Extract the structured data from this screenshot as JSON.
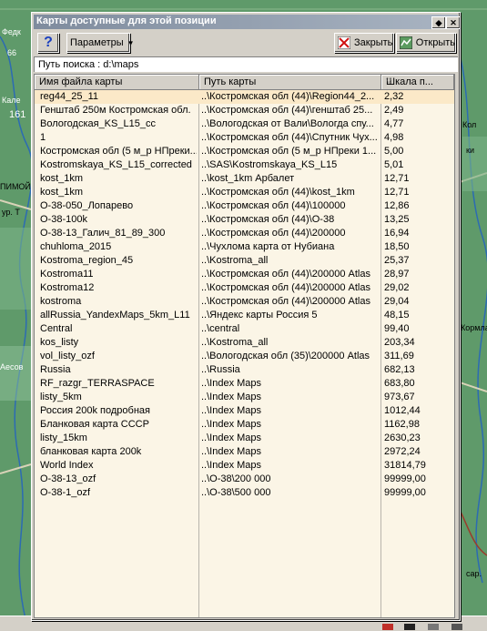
{
  "window": {
    "title": "Карты доступные для этой позиции",
    "pin_icon": "pin-icon",
    "close_icon": "close-icon"
  },
  "toolbar": {
    "help_label": "?",
    "params_label": "Параметры",
    "close_label": "Закрыть",
    "open_label": "Открыть"
  },
  "search": {
    "label": "Путь поиска : d:\\maps"
  },
  "table": {
    "columns": [
      "Имя файла карты",
      "Путь карты",
      "Шкала п..."
    ],
    "rows": [
      [
        "reg44_25_11",
        "..\\Костромская обл (44)\\Region44_2...",
        "2,32"
      ],
      [
        "Генштаб 250м Костромская обл.",
        "..\\Костромская обл (44)\\генштаб 25...",
        "2,49"
      ],
      [
        "Вологодская_KS_L15_cc",
        "..\\Вологодская от Вали\\Вологда спу...",
        "4,77"
      ],
      [
        "1",
        "..\\Костромская обл (44)\\Спутник Чух...",
        "4,98"
      ],
      [
        "Костромская обл (5 м_р НПреки...",
        "..\\Костромская обл (5 м_р НПреки 1...",
        "5,00"
      ],
      [
        "Kostromskaya_KS_L15_corrected",
        "..\\SAS\\Kostromskaya_KS_L15",
        "5,01"
      ],
      [
        "kost_1km",
        "..\\kost_1km Арбалет",
        "12,71"
      ],
      [
        "kost_1km",
        "..\\Костромская обл (44)\\kost_1km",
        "12,71"
      ],
      [
        "O-38-050_Лопарево",
        "..\\Костромская обл (44)\\100000",
        "12,86"
      ],
      [
        "O-38-100k",
        "..\\Костромская обл (44)\\O-38",
        "13,25"
      ],
      [
        "O-38-13_Галич_81_89_300",
        "..\\Костромская обл (44)\\200000",
        "16,94"
      ],
      [
        "chuhloma_2015",
        "..\\Чухлома карта от Нубиана",
        "18,50"
      ],
      [
        "Kostroma_region_45",
        "..\\Kostroma_all",
        "25,37"
      ],
      [
        "Kostroma11",
        "..\\Костромская обл (44)\\200000 Atlas",
        "28,97"
      ],
      [
        "Kostroma12",
        "..\\Костромская обл (44)\\200000 Atlas",
        "29,02"
      ],
      [
        "kostroma",
        "..\\Костромская обл (44)\\200000 Atlas",
        "29,04"
      ],
      [
        "allRussia_YandexMaps_5km_L11",
        "..\\Яндекс карты Россия 5",
        "48,15"
      ],
      [
        "Central",
        "..\\central",
        "99,40"
      ],
      [
        "kos_listy",
        "..\\Kostroma_all",
        "203,34"
      ],
      [
        "vol_listy_ozf",
        "..\\Вологодская обл (35)\\200000 Atlas",
        "311,69"
      ],
      [
        "Russia",
        "..\\Russia",
        "682,13"
      ],
      [
        "RF_razgr_TERRASPACE",
        "..\\Index Maps",
        "683,80"
      ],
      [
        "listy_5km",
        "..\\Index Maps",
        "973,67"
      ],
      [
        "Россия 200k подробная",
        "..\\Index Maps",
        "1012,44"
      ],
      [
        "Бланковая карта СССР",
        "..\\Index Maps",
        "1162,98"
      ],
      [
        "listy_15km",
        "..\\Index Maps",
        "2630,23"
      ],
      [
        "бланковая карта 200k",
        "..\\Index Maps",
        "2972,24"
      ],
      [
        "World Index",
        "..\\Index Maps",
        "31814,79"
      ],
      [
        "O-38-13_ozf",
        "..\\O-38\\200 000",
        "99999,00"
      ],
      [
        "O-38-1_ozf",
        "..\\O-38\\500 000",
        "99999,00"
      ]
    ]
  },
  "map_labels": [
    "Федк",
    "66",
    "Кале",
    "161",
    "ПИМОЙ",
    "ур. Т",
    "Кол",
    "Аесов",
    "Кормла",
    "ки",
    "сар."
  ],
  "colors": {
    "title_start": "#7f8c9e",
    "title_end": "#a9b4c2",
    "grid_bg": "#fbf5e6",
    "selected_row": "#fbe9c8"
  }
}
